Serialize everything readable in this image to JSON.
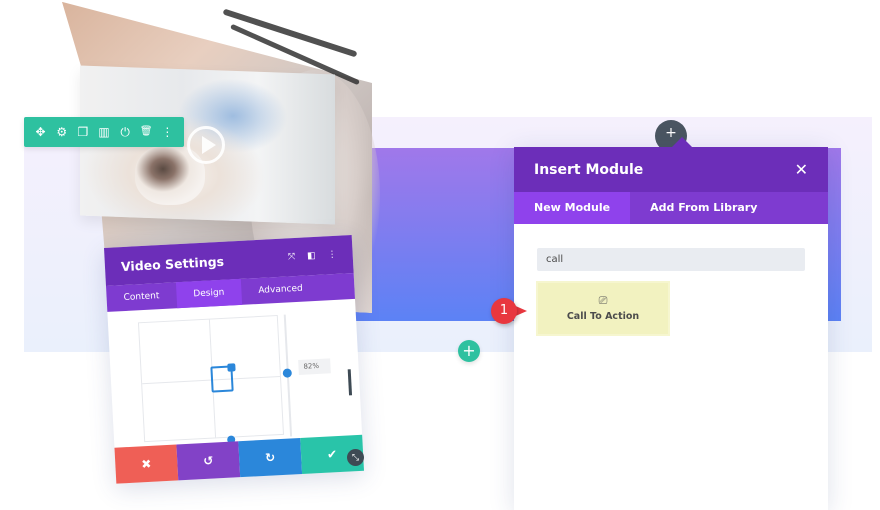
{
  "builder": {
    "module_toolbar": {
      "icons": [
        "move-icon",
        "settings-icon",
        "duplicate-icon",
        "columns-icon",
        "save-to-library-icon",
        "delete-icon",
        "more-options-icon"
      ],
      "glyphs": [
        "✥",
        "⚙",
        "❐",
        "▥",
        "⏻",
        "🗑",
        "⋮"
      ],
      "color": "#2ec1a0"
    },
    "add_row_glyph": "+",
    "add_module_glyph": "+"
  },
  "video_settings": {
    "title": "Video Settings",
    "header_icons": [
      "fullscreen-icon",
      "split-view-icon",
      "more-options-icon"
    ],
    "header_glyphs": [
      "⤧",
      "◧",
      "⋮"
    ],
    "tabs": [
      {
        "label": "Content",
        "active": false
      },
      {
        "label": "Design",
        "active": true
      },
      {
        "label": "Advanced",
        "active": false
      }
    ],
    "slider_value": "82%",
    "footer_buttons": [
      {
        "name": "cancel",
        "glyph": "✖",
        "color": "#ef5f56"
      },
      {
        "name": "undo",
        "glyph": "↺",
        "color": "#8242c7"
      },
      {
        "name": "redo",
        "glyph": "↻",
        "color": "#2b87da"
      },
      {
        "name": "save",
        "glyph": "✔",
        "color": "#29c4a9"
      }
    ],
    "resize_glyph": "⤡"
  },
  "insert_module": {
    "title": "Insert Module",
    "close_glyph": "✕",
    "tabs": [
      {
        "label": "New Module",
        "active": true
      },
      {
        "label": "Add From Library",
        "active": false
      }
    ],
    "search_value": "call",
    "results": [
      {
        "label": "Call To Action",
        "icon": "call-to-action-icon",
        "glyph": "⎚",
        "highlighted": true
      }
    ]
  },
  "callout": {
    "number": "1",
    "color": "#e8373f"
  },
  "colors": {
    "purple_header": "#6c2eb9",
    "purple_tab": "#7e3bd0",
    "purple_active_tab": "#8f42ec",
    "teal": "#2ec1a0",
    "blue": "#2b87da"
  }
}
